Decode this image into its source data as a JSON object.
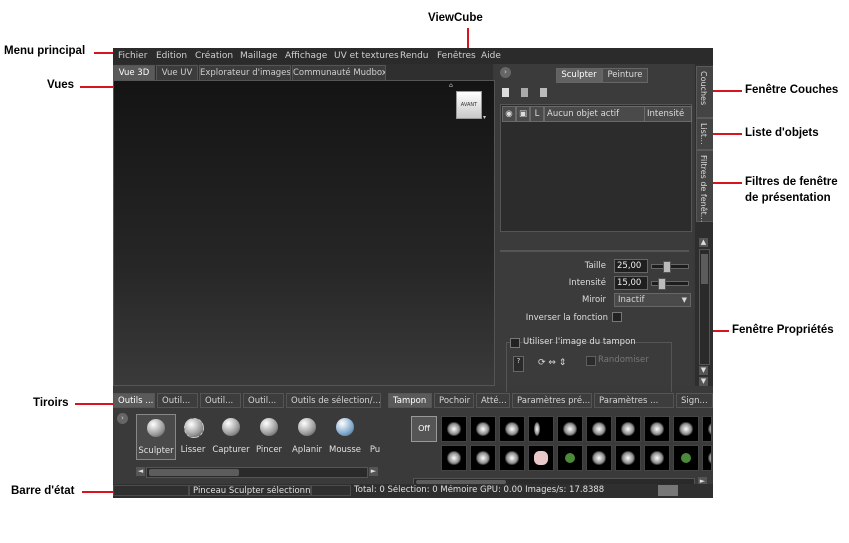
{
  "callouts": {
    "viewcube": "ViewCube",
    "menu_principal": "Menu principal",
    "vues": "Vues",
    "fenetre_couches": "Fenêtre Couches",
    "liste_objets": "Liste d'objets",
    "filtres_line1": "Filtres de fenêtre",
    "filtres_line2": "de présentation",
    "fenetre_proprietes": "Fenêtre Propriétés",
    "tiroirs": "Tiroirs",
    "barre_etat": "Barre d'état"
  },
  "menu": {
    "items": [
      "Fichier",
      "Edition",
      "Création",
      "Maillage",
      "Affichage",
      "UV et textures",
      "Rendu",
      "Fenêtres",
      "Aide"
    ]
  },
  "view_tabs": [
    "Vue 3D",
    "Vue UV",
    "Explorateur d'images",
    "Communauté Mudbox"
  ],
  "viewcube_face": "AVANT",
  "right_panel": {
    "modes": [
      "Sculpter",
      "Peinture"
    ],
    "layers_header": {
      "l_col": "L",
      "name_col": "Aucun objet actif",
      "intensity_col": "Intensité"
    },
    "sidebar_tabs": [
      "Couches",
      "List...",
      "Filtres de fenêt..."
    ],
    "properties": {
      "taille_label": "Taille",
      "taille_value": "25,00",
      "taille_level": 0.25,
      "intensite_label": "Intensité",
      "intensite_value": "15,00",
      "intensite_level": 0.15,
      "miroir_label": "Miroir",
      "miroir_value": "Inactif",
      "inverser_label": "Inverser la fonction",
      "utiliser_label": "Utiliser l'image du tampon",
      "randomiser_label": "Randomiser"
    }
  },
  "drawers": {
    "left_tabs": [
      "Outils ...",
      "Outil...",
      "Outil...",
      "Outil...",
      "Outils de sélection/..."
    ],
    "right_tabs": [
      "Tampon",
      "Pochoir",
      "Atté...",
      "Paramètres pré...",
      "Paramètres ...",
      "Sign..."
    ],
    "tools": [
      "Sculpter",
      "Lisser",
      "Capturer",
      "Pincer",
      "Aplanir",
      "Mousse",
      "Pu"
    ],
    "stamp_off": "Off"
  },
  "status": {
    "message": "Pinceau Sculpter sélectionné",
    "stats": "Total: 0  Sélection: 0 Mémoire GPU: 0.00  Images/s: 17.8388"
  }
}
